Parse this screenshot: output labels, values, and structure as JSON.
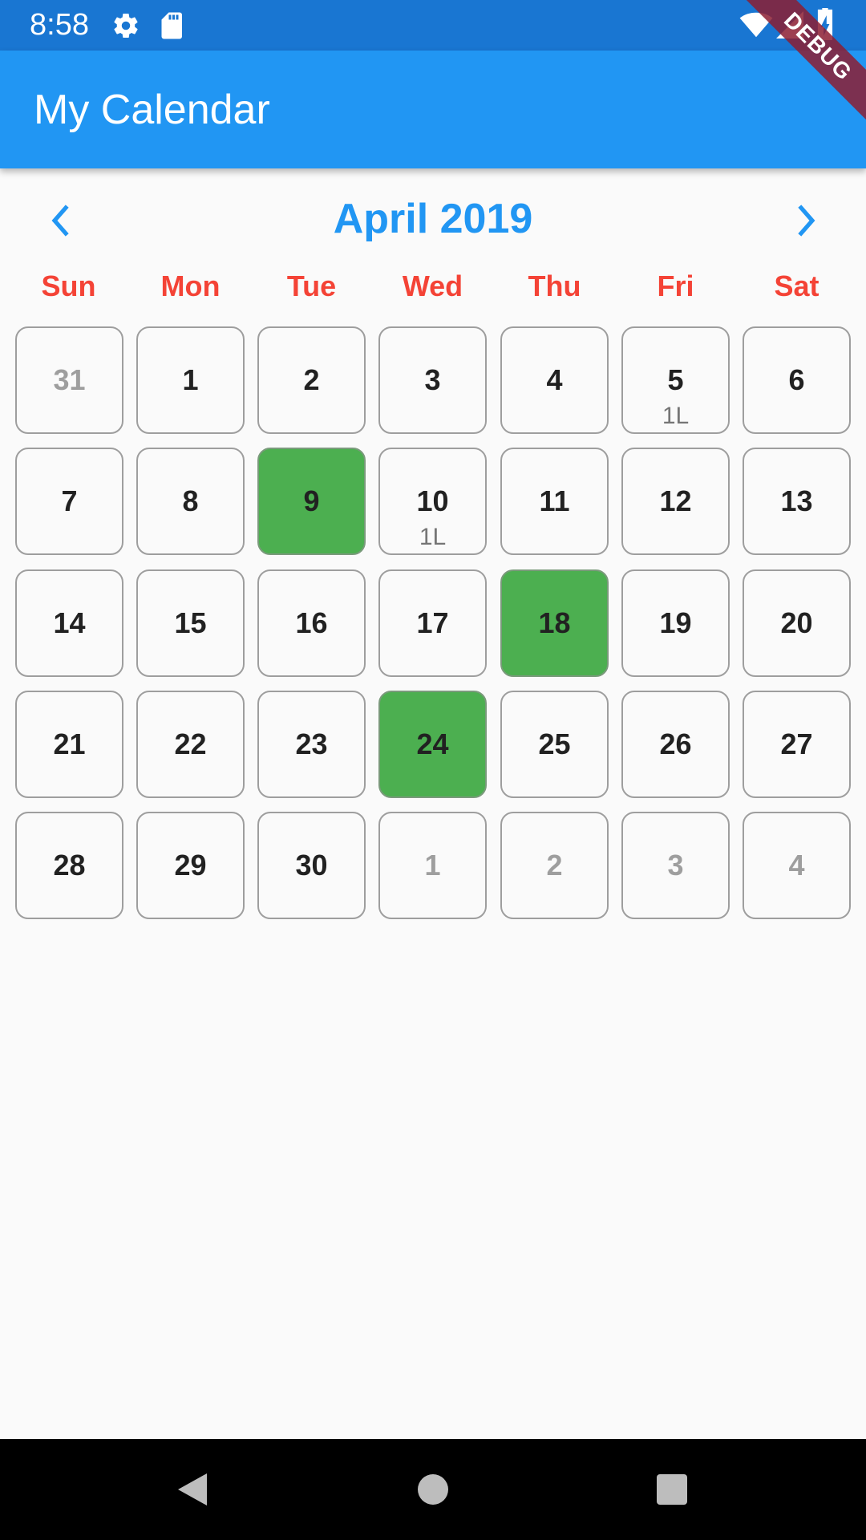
{
  "status_bar": {
    "time": "8:58",
    "icons": [
      "gear-icon",
      "sd-card-icon",
      "wifi-icon",
      "signal-icon",
      "battery-charging-icon"
    ]
  },
  "app_bar": {
    "title": "My Calendar"
  },
  "debug_banner": {
    "label": "DEBUG"
  },
  "calendar": {
    "month_title": "April 2019",
    "prev_icon": "chevron-left-icon",
    "next_icon": "chevron-right-icon",
    "weekdays": [
      "Sun",
      "Mon",
      "Tue",
      "Wed",
      "Thu",
      "Fri",
      "Sat"
    ],
    "weeks": [
      [
        {
          "day": "31",
          "other_month": true,
          "selected": false,
          "note": ""
        },
        {
          "day": "1",
          "other_month": false,
          "selected": false,
          "note": ""
        },
        {
          "day": "2",
          "other_month": false,
          "selected": false,
          "note": ""
        },
        {
          "day": "3",
          "other_month": false,
          "selected": false,
          "note": ""
        },
        {
          "day": "4",
          "other_month": false,
          "selected": false,
          "note": ""
        },
        {
          "day": "5",
          "other_month": false,
          "selected": false,
          "note": "1L"
        },
        {
          "day": "6",
          "other_month": false,
          "selected": false,
          "note": ""
        }
      ],
      [
        {
          "day": "7",
          "other_month": false,
          "selected": false,
          "note": ""
        },
        {
          "day": "8",
          "other_month": false,
          "selected": false,
          "note": ""
        },
        {
          "day": "9",
          "other_month": false,
          "selected": true,
          "note": ""
        },
        {
          "day": "10",
          "other_month": false,
          "selected": false,
          "note": "1L"
        },
        {
          "day": "11",
          "other_month": false,
          "selected": false,
          "note": ""
        },
        {
          "day": "12",
          "other_month": false,
          "selected": false,
          "note": ""
        },
        {
          "day": "13",
          "other_month": false,
          "selected": false,
          "note": ""
        }
      ],
      [
        {
          "day": "14",
          "other_month": false,
          "selected": false,
          "note": ""
        },
        {
          "day": "15",
          "other_month": false,
          "selected": false,
          "note": ""
        },
        {
          "day": "16",
          "other_month": false,
          "selected": false,
          "note": ""
        },
        {
          "day": "17",
          "other_month": false,
          "selected": false,
          "note": ""
        },
        {
          "day": "18",
          "other_month": false,
          "selected": true,
          "note": ""
        },
        {
          "day": "19",
          "other_month": false,
          "selected": false,
          "note": ""
        },
        {
          "day": "20",
          "other_month": false,
          "selected": false,
          "note": ""
        }
      ],
      [
        {
          "day": "21",
          "other_month": false,
          "selected": false,
          "note": ""
        },
        {
          "day": "22",
          "other_month": false,
          "selected": false,
          "note": ""
        },
        {
          "day": "23",
          "other_month": false,
          "selected": false,
          "note": ""
        },
        {
          "day": "24",
          "other_month": false,
          "selected": true,
          "note": ""
        },
        {
          "day": "25",
          "other_month": false,
          "selected": false,
          "note": ""
        },
        {
          "day": "26",
          "other_month": false,
          "selected": false,
          "note": ""
        },
        {
          "day": "27",
          "other_month": false,
          "selected": false,
          "note": ""
        }
      ],
      [
        {
          "day": "28",
          "other_month": false,
          "selected": false,
          "note": ""
        },
        {
          "day": "29",
          "other_month": false,
          "selected": false,
          "note": ""
        },
        {
          "day": "30",
          "other_month": false,
          "selected": false,
          "note": ""
        },
        {
          "day": "1",
          "other_month": true,
          "selected": false,
          "note": ""
        },
        {
          "day": "2",
          "other_month": true,
          "selected": false,
          "note": ""
        },
        {
          "day": "3",
          "other_month": true,
          "selected": false,
          "note": ""
        },
        {
          "day": "4",
          "other_month": true,
          "selected": false,
          "note": ""
        }
      ]
    ]
  },
  "nav_bar": {
    "icons": [
      "back-triangle-icon",
      "home-circle-icon",
      "recents-square-icon"
    ]
  },
  "colors": {
    "app_bar": "#2196f3",
    "status_bar": "#1976d2",
    "accent": "#2196f3",
    "weekday_label": "#f44336",
    "selected_day": "#4caf50",
    "debug_ribbon": "#8c1e32"
  }
}
